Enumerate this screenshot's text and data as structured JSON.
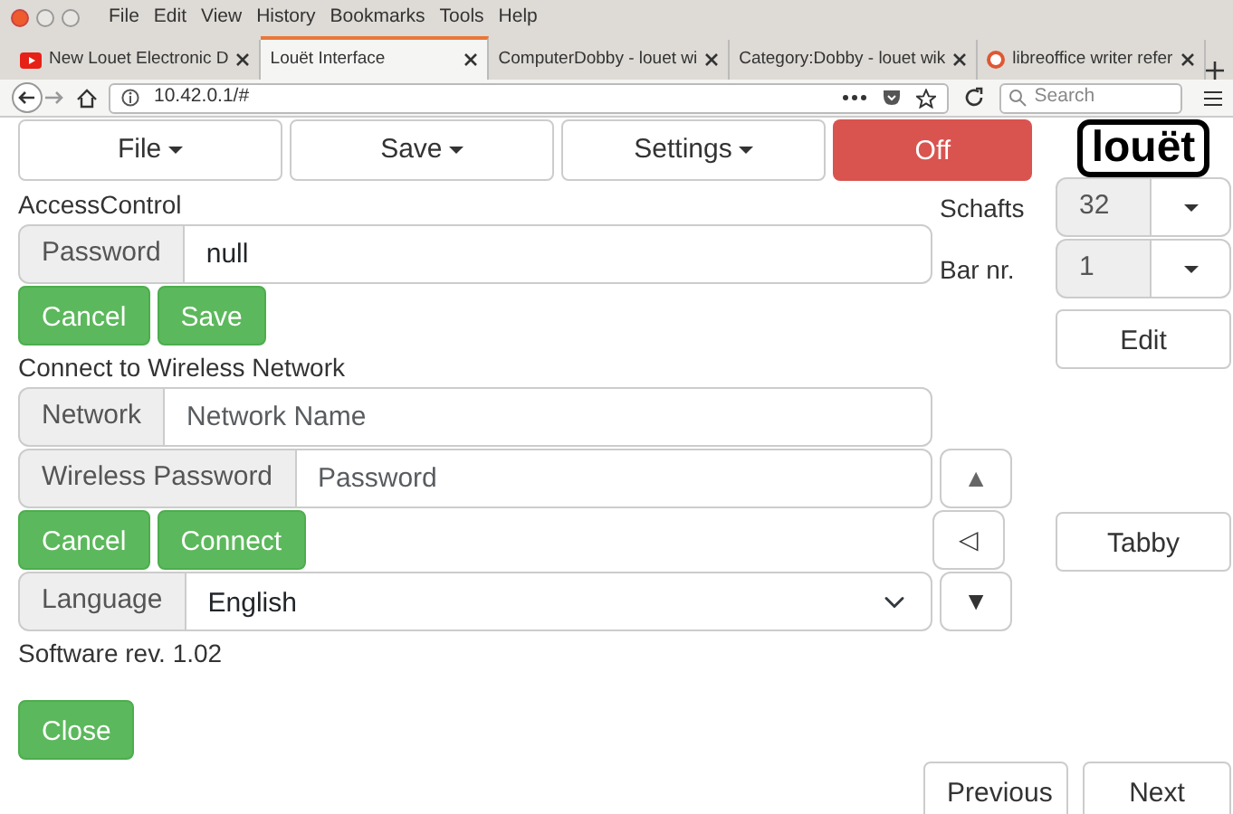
{
  "browser": {
    "menu": [
      "File",
      "Edit",
      "View",
      "History",
      "Bookmarks",
      "Tools",
      "Help"
    ],
    "tabs": [
      {
        "title": "New Louet Electronic D",
        "kind": "video",
        "selected": false
      },
      {
        "title": "Louët Interface",
        "kind": "plain",
        "selected": true
      },
      {
        "title": "ComputerDobby - louet wi",
        "kind": "plain",
        "selected": false
      },
      {
        "title": "Category:Dobby - louet wik",
        "kind": "plain",
        "selected": false
      },
      {
        "title": "libreoffice writer refer",
        "kind": "search",
        "selected": false
      }
    ],
    "url": "10.42.0.1/#",
    "search_placeholder": "Search"
  },
  "toolbar": [
    {
      "label": "File",
      "kind": "dropdown"
    },
    {
      "label": "Save",
      "kind": "dropdown"
    },
    {
      "label": "Settings",
      "kind": "dropdown"
    },
    {
      "label": "Off",
      "kind": "toggle",
      "on": false
    }
  ],
  "logo": "louët",
  "access_control": {
    "heading": "AccessControl",
    "password_label": "Password",
    "password_value": "null",
    "buttons": [
      "Cancel",
      "Save"
    ]
  },
  "wireless": {
    "heading": "Connect to Wireless Network",
    "network_label": "Network",
    "network_placeholder": "Network Name",
    "password_label": "Wireless Password",
    "password_placeholder": "Password",
    "buttons": [
      "Cancel",
      "Connect"
    ]
  },
  "language": {
    "label": "Language",
    "value": "English"
  },
  "software_rev": "Software rev. 1.02",
  "close_button": "Close",
  "schafts": {
    "label": "Schafts",
    "value": "32"
  },
  "bar": {
    "label": "Bar nr.",
    "value": "1"
  },
  "edit_button": "Edit",
  "arrows": [
    {
      "symbol": "▲",
      "kind": "up"
    },
    {
      "symbol": "◁",
      "kind": "left"
    },
    {
      "symbol": "▼",
      "kind": "down"
    }
  ],
  "tabby_button": "Tabby",
  "nav_buttons": [
    "Previous",
    "Next"
  ]
}
